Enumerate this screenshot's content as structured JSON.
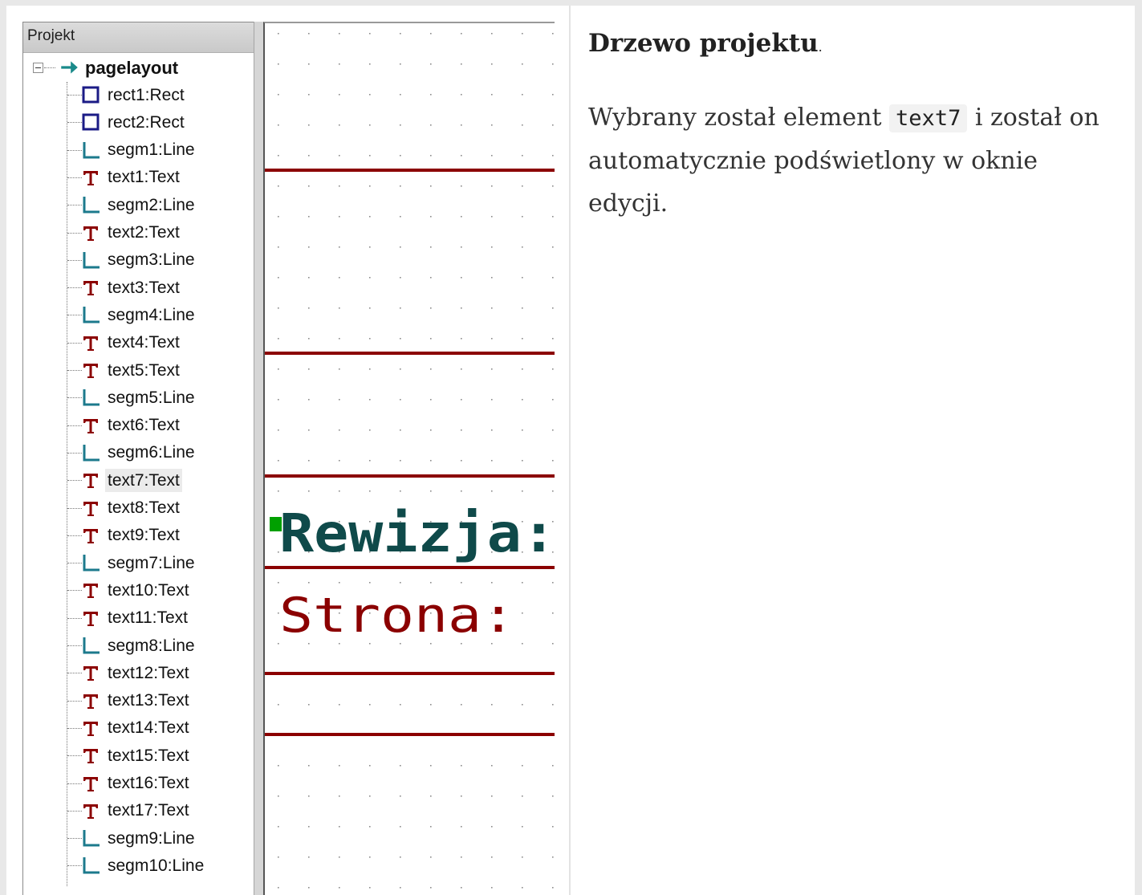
{
  "tree_panel": {
    "header": "Projekt",
    "root": "pagelayout",
    "items": [
      {
        "label": "rect1:Rect",
        "type": "rect"
      },
      {
        "label": "rect2:Rect",
        "type": "rect"
      },
      {
        "label": "segm1:Line",
        "type": "line"
      },
      {
        "label": "text1:Text",
        "type": "text"
      },
      {
        "label": "segm2:Line",
        "type": "line"
      },
      {
        "label": "text2:Text",
        "type": "text"
      },
      {
        "label": "segm3:Line",
        "type": "line"
      },
      {
        "label": "text3:Text",
        "type": "text"
      },
      {
        "label": "segm4:Line",
        "type": "line"
      },
      {
        "label": "text4:Text",
        "type": "text"
      },
      {
        "label": "text5:Text",
        "type": "text"
      },
      {
        "label": "segm5:Line",
        "type": "line"
      },
      {
        "label": "text6:Text",
        "type": "text"
      },
      {
        "label": "segm6:Line",
        "type": "line"
      },
      {
        "label": "text7:Text",
        "type": "text",
        "selected": true
      },
      {
        "label": "text8:Text",
        "type": "text"
      },
      {
        "label": "text9:Text",
        "type": "text"
      },
      {
        "label": "segm7:Line",
        "type": "line"
      },
      {
        "label": "text10:Text",
        "type": "text"
      },
      {
        "label": "text11:Text",
        "type": "text"
      },
      {
        "label": "segm8:Line",
        "type": "line"
      },
      {
        "label": "text12:Text",
        "type": "text"
      },
      {
        "label": "text13:Text",
        "type": "text"
      },
      {
        "label": "text14:Text",
        "type": "text"
      },
      {
        "label": "text15:Text",
        "type": "text"
      },
      {
        "label": "text16:Text",
        "type": "text"
      },
      {
        "label": "text17:Text",
        "type": "text"
      },
      {
        "label": "segm9:Line",
        "type": "line"
      },
      {
        "label": "segm10:Line",
        "type": "line"
      }
    ]
  },
  "editor": {
    "highlighted_text": "Rewizja:",
    "other_text": "Strona:"
  },
  "description": {
    "title": "Drzewo projektu",
    "title_suffix": ".",
    "text_before": "Wybrany został element ",
    "code": "text7",
    "text_after": " i został on automatycznie podświetlony w oknie edycji."
  },
  "colors": {
    "rect_icon": "#1b1b86",
    "line_icon": "#1c7a8c",
    "text_icon": "#8b0000",
    "root_arrow": "#1a8a8a",
    "canvas_line": "#8b0000",
    "highlight_text": "#0f4a4a",
    "anchor": "#00a000"
  }
}
